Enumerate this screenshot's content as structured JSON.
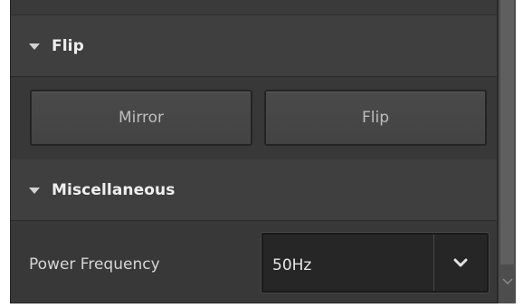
{
  "sections": {
    "flip": {
      "title": "Flip",
      "buttons": {
        "mirror": "Mirror",
        "flip": "Flip"
      }
    },
    "miscellaneous": {
      "title": "Miscellaneous",
      "power_frequency": {
        "label": "Power Frequency",
        "value": "50Hz"
      }
    }
  },
  "icons": {
    "section_toggle": "triangle-down-icon",
    "dropdown": "chevron-down-icon",
    "scroll_down": "chevron-down-icon"
  },
  "colors": {
    "panel_bg": "#383838",
    "header_bg": "#3f3f3f",
    "select_bg": "#262626",
    "text": "#efefef"
  }
}
